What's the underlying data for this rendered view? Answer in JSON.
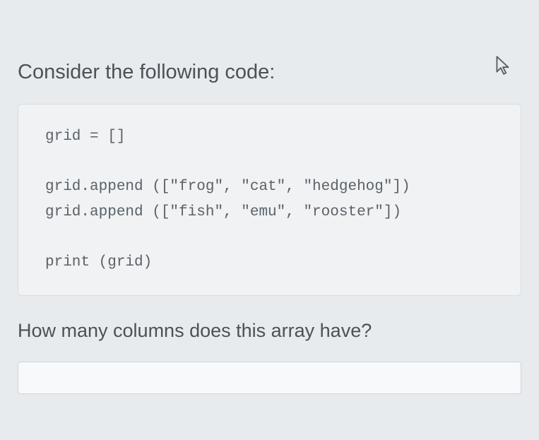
{
  "question": {
    "intro": "Consider the following code:",
    "prompt": "How many columns does this array have?"
  },
  "code": {
    "lines": [
      "grid = []",
      "",
      "grid.append ([\"frog\", \"cat\", \"hedgehog\"])",
      "grid.append ([\"fish\", \"emu\", \"rooster\"])",
      "",
      "print (grid)"
    ]
  },
  "answer": {
    "value": ""
  }
}
